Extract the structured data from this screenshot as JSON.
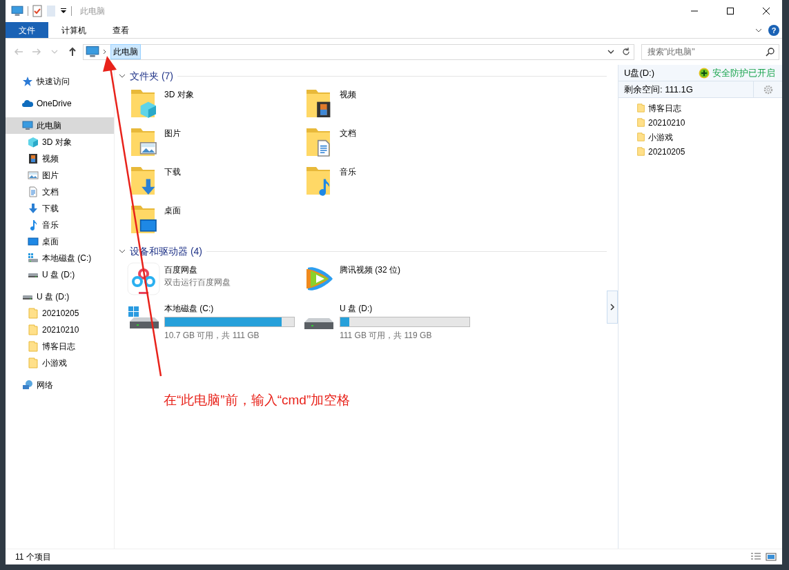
{
  "window": {
    "title": "此电脑"
  },
  "ribbon_tabs": [
    {
      "label": "文件",
      "selected": true
    },
    {
      "label": "计算机",
      "selected": false
    },
    {
      "label": "查看",
      "selected": false
    }
  ],
  "help_button": "?",
  "nav_buttons": [
    {
      "kind": "back",
      "disabled": true
    },
    {
      "kind": "forward",
      "disabled": true
    },
    {
      "kind": "recent",
      "disabled": true
    },
    {
      "kind": "up",
      "disabled": false
    }
  ],
  "address": {
    "path": "此电脑"
  },
  "search": {
    "placeholder": "搜索\"此电脑\""
  },
  "nav_pane": [
    {
      "label": "快速访问",
      "kind": "star",
      "selected": false
    },
    {
      "label": "OneDrive",
      "kind": "cloud",
      "selected": false
    },
    {
      "label": "此电脑",
      "kind": "pc",
      "selected": true,
      "children": [
        {
          "label": "3D 对象",
          "kind": "cube",
          "selected": false
        },
        {
          "label": "视频",
          "kind": "film",
          "selected": false
        },
        {
          "label": "图片",
          "kind": "image",
          "selected": false
        },
        {
          "label": "文档",
          "kind": "doc",
          "selected": false
        },
        {
          "label": "下载",
          "kind": "download",
          "selected": false
        },
        {
          "label": "音乐",
          "kind": "music",
          "selected": false
        },
        {
          "label": "桌面",
          "kind": "desktop",
          "selected": false
        },
        {
          "label": "本地磁盘 (C:)",
          "kind": "windrive",
          "selected": false
        },
        {
          "label": "U 盘 (D:)",
          "kind": "drive",
          "selected": false
        }
      ]
    },
    {
      "label": "U 盘 (D:)",
      "kind": "drive",
      "selected": false,
      "children": [
        {
          "label": "20210205",
          "kind": "folder",
          "selected": false
        },
        {
          "label": "20210210",
          "kind": "folder",
          "selected": false
        },
        {
          "label": "博客日志",
          "kind": "folder",
          "selected": false
        },
        {
          "label": "小游戏",
          "kind": "folder",
          "selected": false
        }
      ]
    },
    {
      "label": "网络",
      "kind": "network",
      "selected": false
    }
  ],
  "sections": [
    {
      "title": "文件夹 (7)",
      "expanded": true,
      "items": [
        {
          "kind": "cube",
          "name": "3D 对象"
        },
        {
          "kind": "film",
          "name": "视频"
        },
        {
          "kind": "image",
          "name": "图片"
        },
        {
          "kind": "doc",
          "name": "文档"
        },
        {
          "kind": "download",
          "name": "下载"
        },
        {
          "kind": "music",
          "name": "音乐"
        },
        {
          "kind": "desktop",
          "name": "桌面"
        }
      ]
    },
    {
      "title": "设备和驱动器 (4)",
      "expanded": true,
      "items": [
        {
          "kind": "cloud-app",
          "name": "百度网盘",
          "subtitle": "双击运行百度网盘"
        },
        {
          "kind": "video-app",
          "name": "腾讯视频 (32 位)"
        },
        {
          "kind": "system-drive",
          "name": "本地磁盘 (C:)",
          "level": 0.904,
          "free": "10.7 GB 可用，共 111 GB"
        },
        {
          "kind": "drive",
          "name": "U 盘 (D:)",
          "level": 0.067,
          "free": "111 GB 可用，共 119 GB"
        }
      ]
    }
  ],
  "side_panel": {
    "drive": "U盘(D:)",
    "protection": "安全防护已开启",
    "free_space": "剩余空间: 111.1G",
    "folders": [
      {
        "label": "博客日志"
      },
      {
        "label": "20210210"
      },
      {
        "label": "小游戏"
      },
      {
        "label": "20210205"
      }
    ]
  },
  "status_bar": {
    "count": "11 个项目"
  },
  "annotation": {
    "text": "在“此电脑”前，输入“cmd”加空格"
  }
}
